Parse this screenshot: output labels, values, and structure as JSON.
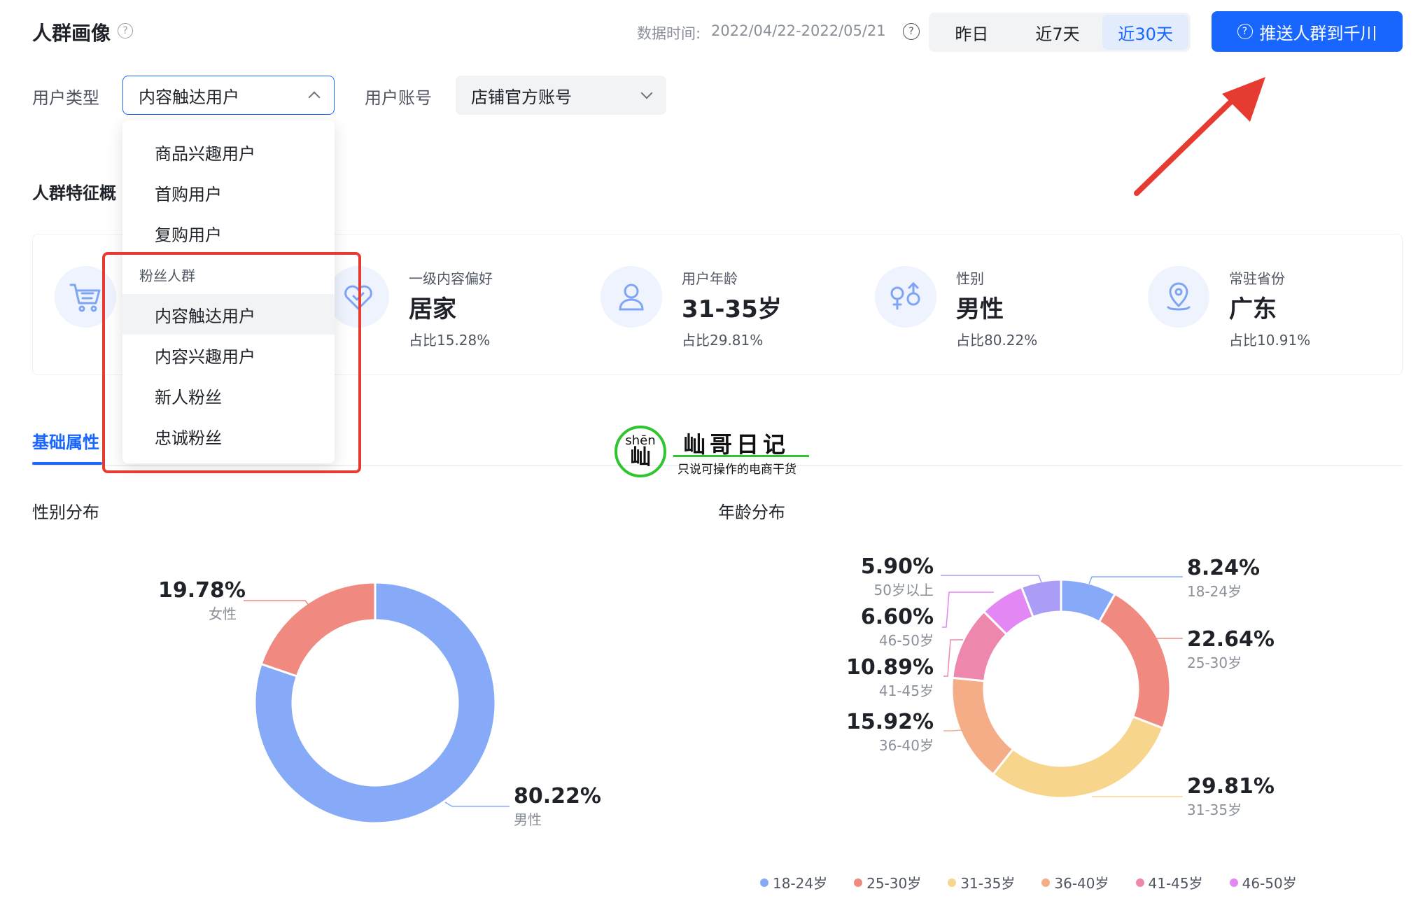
{
  "header": {
    "title": "人群画像",
    "data_time_label": "数据时间:",
    "data_time_value": "2022/04/22-2022/05/21",
    "ranges": [
      "昨日",
      "近7天",
      "近30天"
    ],
    "active_range": "近30天",
    "push_button": "推送人群到千川",
    "help_glyph": "?"
  },
  "filters": {
    "user_type_label": "用户类型",
    "user_type_value": "内容触达用户",
    "account_label": "用户账号",
    "account_value": "店铺官方账号"
  },
  "dropdown": {
    "items_top": [
      "商品兴趣用户",
      "首购用户",
      "复购用户"
    ],
    "group_label": "粉丝人群",
    "items_group": [
      "内容触达用户",
      "内容兴趣用户",
      "新人粉丝",
      "忠诚粉丝"
    ],
    "selected": "内容触达用户"
  },
  "section_overview_title": "人群特征概",
  "overview": [
    {
      "icon": "cart-icon",
      "label": "",
      "value": "",
      "pct": ""
    },
    {
      "icon": "heart-tag-icon",
      "label": "一级内容偏好",
      "value": "居家",
      "pct": "占比15.28%"
    },
    {
      "icon": "user-icon",
      "label": "用户年龄",
      "value": "31-35岁",
      "pct": "占比29.81%"
    },
    {
      "icon": "gender-icon",
      "label": "性别",
      "value": "男性",
      "pct": "占比80.22%"
    },
    {
      "icon": "location-icon",
      "label": "常驻省份",
      "value": "广东",
      "pct": "占比10.91%"
    }
  ],
  "tabs": {
    "basic": "基础属性"
  },
  "watermark": {
    "pinyin": "shēn",
    "char": "屾",
    "title": "屾哥日记",
    "subtitle": "只说可操作的电商干货"
  },
  "colors": {
    "accent": "#1966ff",
    "annotation_red": "#e63b30"
  },
  "chart_data": [
    {
      "type": "pie",
      "title": "性别分布",
      "categories": [
        "男性",
        "女性"
      ],
      "values": [
        80.22,
        19.78
      ],
      "labels": [
        "80.22%",
        "19.78%"
      ],
      "colors": [
        "#86aaf8",
        "#f08a80"
      ]
    },
    {
      "type": "pie",
      "title": "年龄分布",
      "categories": [
        "18-24岁",
        "25-30岁",
        "31-35岁",
        "36-40岁",
        "41-45岁",
        "46-50岁",
        "50岁以上"
      ],
      "values": [
        8.24,
        22.64,
        29.81,
        15.92,
        10.89,
        6.6,
        5.9
      ],
      "labels": [
        "8.24%",
        "22.64%",
        "29.81%",
        "15.92%",
        "10.89%",
        "6.60%",
        "5.90%"
      ],
      "colors": [
        "#86aaf8",
        "#f08a80",
        "#f7d58c",
        "#f5ad87",
        "#ee87ad",
        "#e387f5",
        "#ab9cf5"
      ],
      "legend": [
        "18-24岁",
        "25-30岁",
        "31-35岁",
        "36-40岁",
        "41-45岁",
        "46-50岁"
      ]
    }
  ]
}
